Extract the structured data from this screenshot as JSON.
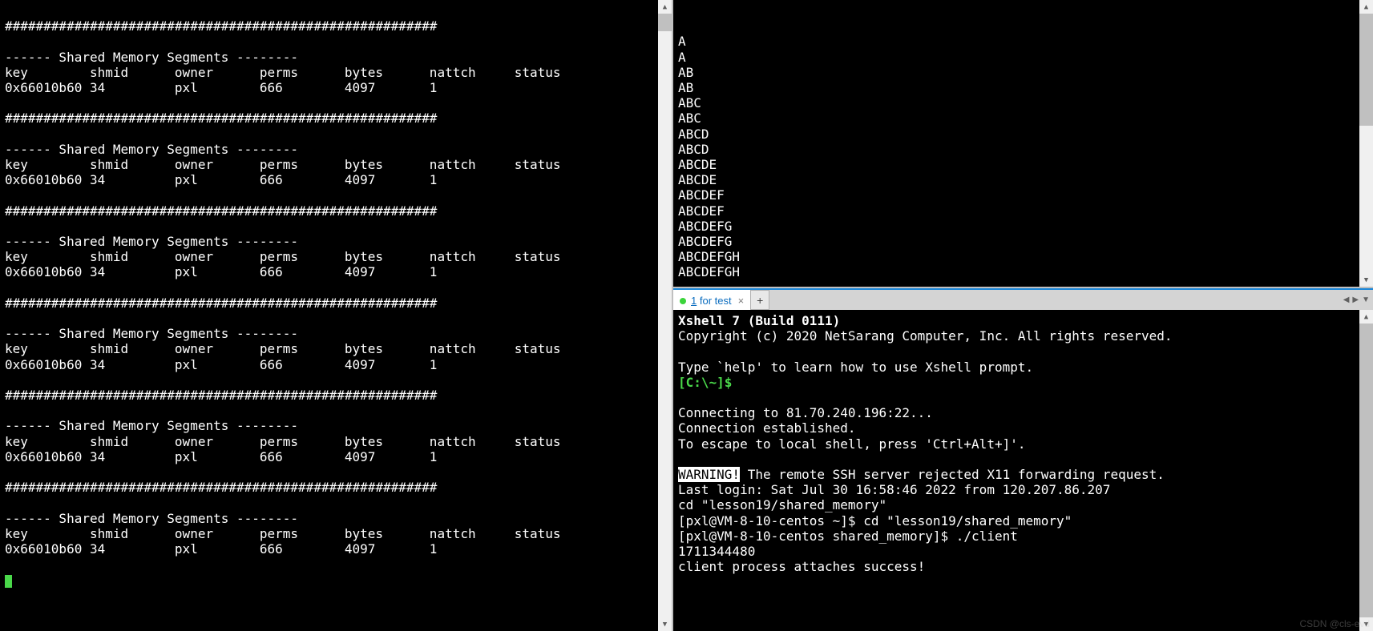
{
  "left_pane": {
    "blank_first": "",
    "divider": "########################################################",
    "section_title": "------ Shared Memory Segments --------",
    "headers": [
      "key",
      "shmid",
      "owner",
      "perms",
      "bytes",
      "nattch",
      "status"
    ],
    "row": {
      "key": "0x66010b60",
      "shmid": "34",
      "owner": "pxl",
      "perms": "666",
      "bytes": "4097",
      "nattch": "1",
      "status": ""
    },
    "repeat_count": 6
  },
  "top_right": {
    "blank_lines": 2,
    "lines": [
      "A",
      "A",
      "AB",
      "AB",
      "ABC",
      "ABC",
      "ABCD",
      "ABCD",
      "ABCDE",
      "ABCDE",
      "ABCDEF",
      "ABCDEF",
      "ABCDEFG",
      "ABCDEFG",
      "ABCDEFGH",
      "ABCDEFGH"
    ]
  },
  "tabbar": {
    "tab_prefix": "1",
    "tab_label": " for test",
    "close_glyph": "×",
    "add_glyph": "+",
    "nav_left": "◀",
    "nav_right": "▶",
    "nav_menu": "▼"
  },
  "bottom_right": {
    "title": "Xshell 7 (Build 0111)",
    "copyright": "Copyright (c) 2020 NetSarang Computer, Inc. All rights reserved.",
    "help_line": "Type `help' to learn how to use Xshell prompt.",
    "prompt": "[C:\\~]$",
    "connecting": "Connecting to 81.70.240.196:22...",
    "established": "Connection established.",
    "escape": "To escape to local shell, press 'Ctrl+Alt+]'.",
    "warning_label": "WARNING!",
    "warning_rest": " The remote SSH server rejected X11 forwarding request.",
    "last_login": "Last login: Sat Jul 30 16:58:46 2022 from 120.207.86.207",
    "cd_echo": "cd \"lesson19/shared_memory\"",
    "prompt1": "[pxl@VM-8-10-centos ~]$ ",
    "cmd1": "cd \"lesson19/shared_memory\"",
    "prompt2": "[pxl@VM-8-10-centos shared_memory]$ ",
    "cmd2": "./client",
    "out_num": "1711344480",
    "out_msg": "client process attaches success!"
  },
  "watermark": "CSDN @cls-evd",
  "scroll": {
    "up": "▲",
    "down": "▼"
  }
}
